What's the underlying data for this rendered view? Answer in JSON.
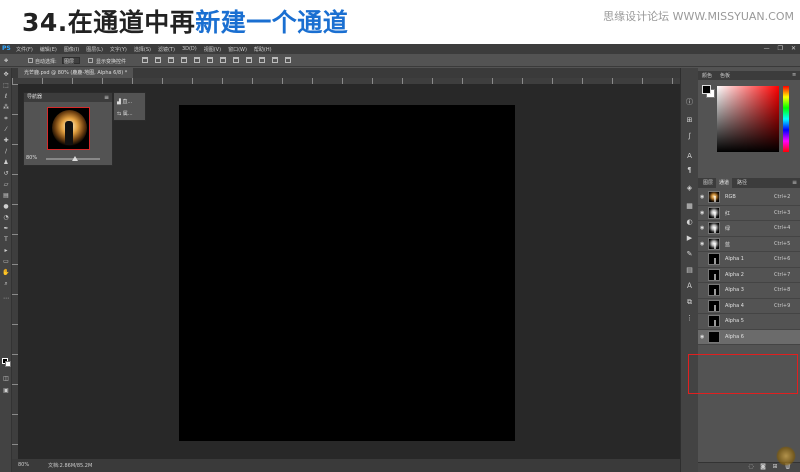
{
  "header": {
    "title_prefix": "34.在通道中再",
    "title_highlight": "新建一个通道",
    "site": "思缘设计论坛 WWW.MISSYUAN.COM"
  },
  "ps": {
    "logo": "PS",
    "menus": [
      "文件(F)",
      "编辑(E)",
      "图像(I)",
      "图层(L)",
      "文字(Y)",
      "选择(S)",
      "滤镜(T)",
      "3D(D)",
      "视图(V)",
      "窗口(W)",
      "帮助(H)"
    ],
    "window_buttons": [
      "—",
      "❐",
      "✕"
    ],
    "options": {
      "auto_select_label": "自动选择:",
      "auto_select_value": "图层",
      "transform_label": "显示变换控件"
    },
    "document_tab": "光芒鹿.psd @ 80% (鹿鹿-地图, Alpha 6/8) *",
    "status": {
      "zoom": "80%",
      "doc": "文档:2.86M/85.2M"
    },
    "navigator": {
      "title": "导航器",
      "zoom": "80%"
    },
    "histogram_rows": [
      "直...",
      "属..."
    ],
    "color_panel": {
      "tabs": [
        "颜色",
        "色板"
      ]
    },
    "channels_panel": {
      "tabs": [
        "图层",
        "通道",
        "路径"
      ],
      "active_tab": "通道",
      "channels": [
        {
          "name": "RGB",
          "shortcut": "Ctrl+2"
        },
        {
          "name": "红",
          "shortcut": "Ctrl+3"
        },
        {
          "name": "绿",
          "shortcut": "Ctrl+4"
        },
        {
          "name": "蓝",
          "shortcut": "Ctrl+5"
        },
        {
          "name": "Alpha 1",
          "shortcut": "Ctrl+6"
        },
        {
          "name": "Alpha 2",
          "shortcut": "Ctrl+7"
        },
        {
          "name": "Alpha 3",
          "shortcut": "Ctrl+8"
        },
        {
          "name": "Alpha 4",
          "shortcut": "Ctrl+9"
        },
        {
          "name": "Alpha 5",
          "shortcut": ""
        },
        {
          "name": "Alpha 6",
          "shortcut": ""
        }
      ],
      "selected": "Alpha 6"
    },
    "colors": {
      "highlight": "#e02020",
      "title_accent": "#1a6fd1"
    }
  }
}
